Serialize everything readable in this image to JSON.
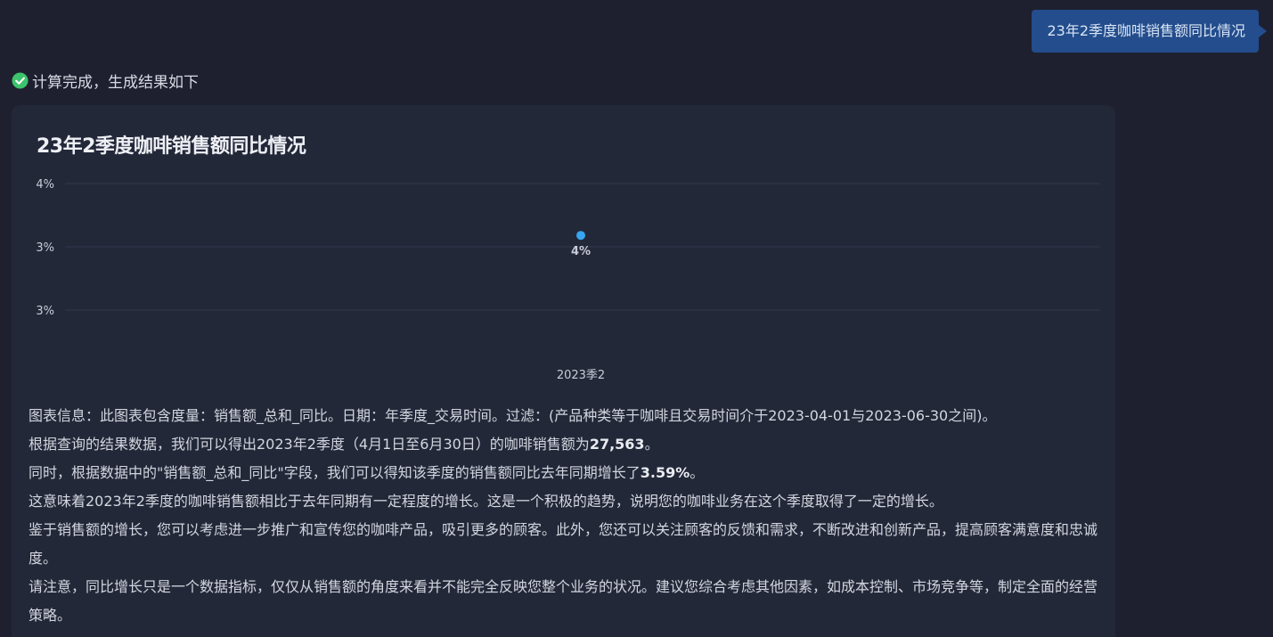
{
  "user_message": "23年2季度咖啡销售额同比情况",
  "status": {
    "text": "计算完成，生成结果如下",
    "icon": "check-circle-icon",
    "icon_color": "#3cc36b"
  },
  "card": {
    "title": "23年2季度咖啡销售额同比情况"
  },
  "chart_data": {
    "type": "scatter",
    "title": "23年2季度咖啡销售额同比情况",
    "categories": [
      "2023季2"
    ],
    "series": [
      {
        "values": [
          3.59
        ],
        "data_labels": [
          "4%"
        ],
        "color": "#36a6f2"
      }
    ],
    "y_ticks": [
      3,
      3.5,
      4
    ],
    "y_tick_labels": [
      "3%",
      "3%",
      "4%"
    ],
    "ylim": [
      3,
      4
    ],
    "grid": true,
    "legend": false
  },
  "summary": {
    "line1": "图表信息：此图表包含度量：销售额_总和_同比。日期：年季度_交易时间。过滤：(产品种类等于咖啡且交易时间介于2023-04-01与2023-06-30之间)。",
    "line2_pre": "根据查询的结果数据，我们可以得出2023年2季度（4月1日至6月30日）的咖啡销售额为",
    "line2_value": "27,563",
    "line2_post": "。",
    "line3_pre": "同时，根据数据中的\"销售额_总和_同比\"字段，我们可以得知该季度的销售额同比去年同期增长了",
    "line3_value": "3.59%",
    "line3_post": "。",
    "line4": "这意味着2023年2季度的咖啡销售额相比于去年同期有一定程度的增长。这是一个积极的趋势，说明您的咖啡业务在这个季度取得了一定的增长。",
    "line5": "鉴于销售额的增长，您可以考虑进一步推广和宣传您的咖啡产品，吸引更多的顾客。此外，您还可以关注顾客的反馈和需求，不断改进和创新产品，提高顾客满意度和忠诚度。",
    "line6": "请注意，同比增长只是一个数据指标，仅仅从销售额的角度来看并不能完全反映您整个业务的状况。建议您综合考虑其他因素，如成本控制、市场竞争等，制定全面的经营策略。"
  }
}
